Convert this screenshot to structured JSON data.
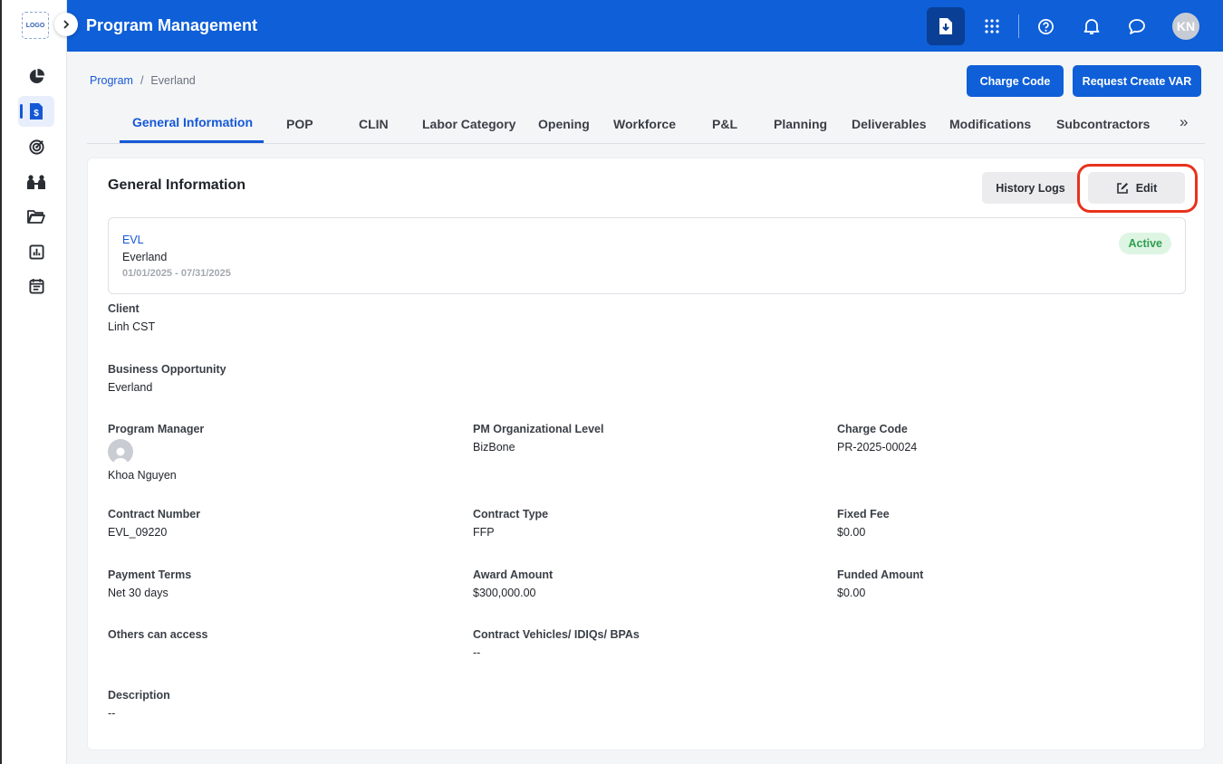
{
  "app": {
    "logo_text": "LOGO",
    "title": "Program Management",
    "user_initials": "KN"
  },
  "breadcrumb": {
    "root": "Program",
    "current": "Everland"
  },
  "actions": {
    "charge_code": "Charge Code",
    "request_var": "Request Create VAR"
  },
  "tabs": [
    {
      "label": "General Information",
      "active": true
    },
    {
      "label": "POP"
    },
    {
      "label": "CLIN"
    },
    {
      "label": "Labor Category"
    },
    {
      "label": "Opening"
    },
    {
      "label": "Workforce"
    },
    {
      "label": "P&L"
    },
    {
      "label": "Planning"
    },
    {
      "label": "Deliverables"
    },
    {
      "label": "Modifications"
    },
    {
      "label": "Subcontractors"
    }
  ],
  "tabs_more": "»",
  "card": {
    "title": "General Information",
    "history_logs": "History Logs",
    "edit": "Edit"
  },
  "summary": {
    "code": "EVL",
    "name": "Everland",
    "dates": "01/01/2025 - 07/31/2025",
    "status": "Active"
  },
  "fields": {
    "client": {
      "label": "Client",
      "value": "Linh CST"
    },
    "business_opportunity": {
      "label": "Business Opportunity",
      "value": "Everland"
    },
    "program_manager": {
      "label": "Program Manager",
      "value": "Khoa Nguyen"
    },
    "pm_org_level": {
      "label": "PM Organizational Level",
      "value": "BizBone"
    },
    "charge_code": {
      "label": "Charge Code",
      "value": "PR-2025-00024"
    },
    "contract_number": {
      "label": "Contract Number",
      "value": "EVL_09220"
    },
    "contract_type": {
      "label": "Contract Type",
      "value": "FFP"
    },
    "fixed_fee": {
      "label": "Fixed Fee",
      "value": "$0.00"
    },
    "payment_terms": {
      "label": "Payment Terms",
      "value": "Net 30 days"
    },
    "award_amount": {
      "label": "Award Amount",
      "value": "$300,000.00"
    },
    "funded_amount": {
      "label": "Funded Amount",
      "value": "$0.00"
    },
    "others_access": {
      "label": "Others can access",
      "value": ""
    },
    "contract_vehicles": {
      "label": "Contract Vehicles/ IDIQs/ BPAs",
      "value": "--"
    },
    "description": {
      "label": "Description",
      "value": "--"
    }
  },
  "colors": {
    "primary": "#0e5fd8",
    "highlight": "#e8321c",
    "status_active_bg": "#dff5e4",
    "status_active_text": "#2f9e4f"
  },
  "icons": {
    "rail": [
      "pie-chart-icon",
      "contract-dollar-icon",
      "target-icon",
      "team-icon",
      "folder-icon",
      "report-icon",
      "calendar-icon"
    ],
    "header": [
      "download-doc-icon",
      "apps-grid-icon",
      "help-icon",
      "bell-icon",
      "chat-icon"
    ]
  }
}
